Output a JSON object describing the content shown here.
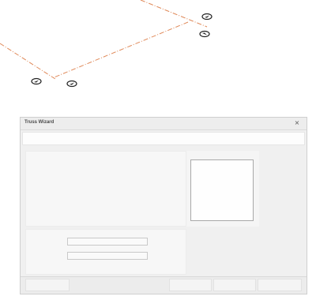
{
  "window": {
    "title": "Truss Wizard",
    "close_symbol": "×"
  },
  "canvas": {
    "line_color": "#e08a5a",
    "markers": [
      "section-marker-icon",
      "section-marker-icon",
      "section-marker-icon",
      "section-marker-icon"
    ]
  },
  "form": {
    "field_1_value": "",
    "field_2_value": ""
  },
  "footer": {
    "buttons": [
      "",
      "",
      "",
      ""
    ]
  },
  "colors": {
    "dialog_bg": "#f0f0f0",
    "border": "#cfcfcf"
  }
}
